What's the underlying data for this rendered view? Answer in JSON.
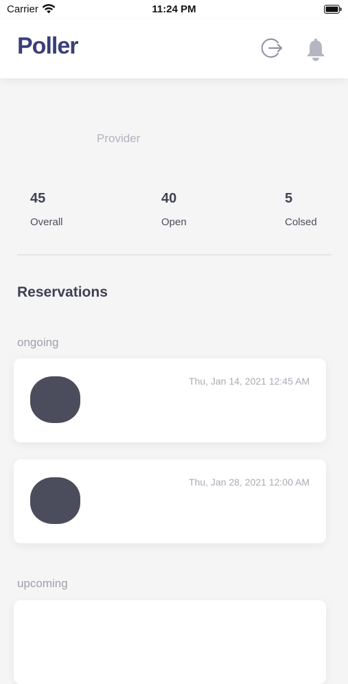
{
  "status_bar": {
    "carrier": "Carrier",
    "time": "11:24 PM",
    "icons": [
      "wifi-icon",
      "battery-icon"
    ]
  },
  "header": {
    "brand": "Poller",
    "brand_color": "#3b3f78",
    "actions": [
      "logout-icon",
      "bell-icon"
    ]
  },
  "profile": {
    "role": "Provider"
  },
  "stats": [
    {
      "value": "45",
      "label": "Overall"
    },
    {
      "value": "40",
      "label": "Open"
    },
    {
      "value": "5",
      "label": "Colsed"
    }
  ],
  "reservations": {
    "title": "Reservations",
    "groups": [
      {
        "label": "ongoing",
        "items": [
          {
            "date": "Thu, Jan 14, 2021 12:45 AM"
          },
          {
            "date": "Thu, Jan 28, 2021 12:00 AM"
          }
        ]
      },
      {
        "label": "upcoming",
        "items": []
      }
    ]
  }
}
